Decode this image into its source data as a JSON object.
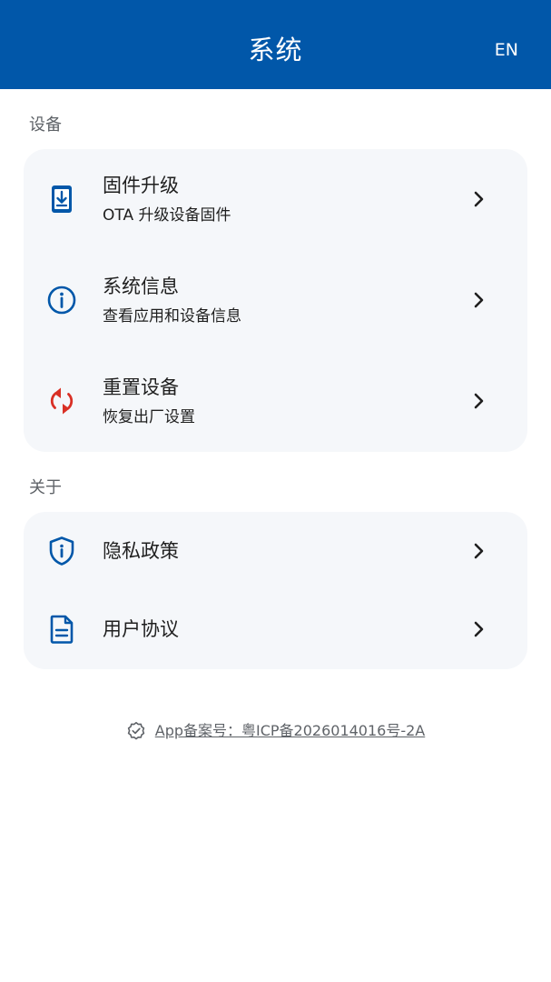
{
  "header": {
    "title": "系统",
    "lang_label": "EN"
  },
  "sections": {
    "device": {
      "label": "设备",
      "items": [
        {
          "title": "固件升级",
          "subtitle": "OTA 升级设备固件",
          "icon": "firmware-download-icon"
        },
        {
          "title": "系统信息",
          "subtitle": "查看应用和设备信息",
          "icon": "info-icon"
        },
        {
          "title": "重置设备",
          "subtitle": "恢复出厂设置",
          "icon": "reset-icon"
        }
      ]
    },
    "about": {
      "label": "关于",
      "items": [
        {
          "title": "隐私政策",
          "icon": "privacy-shield-icon"
        },
        {
          "title": "用户协议",
          "icon": "document-icon"
        }
      ]
    }
  },
  "footer": {
    "icp_text": "App备案号：粤ICP备2026014016号-2A",
    "icon": "verified-badge-icon"
  },
  "colors": {
    "header_bg": "#0157A9",
    "accent_blue": "#0157A9",
    "reset_red": "#D93025",
    "card_bg": "#F5F7FA"
  }
}
